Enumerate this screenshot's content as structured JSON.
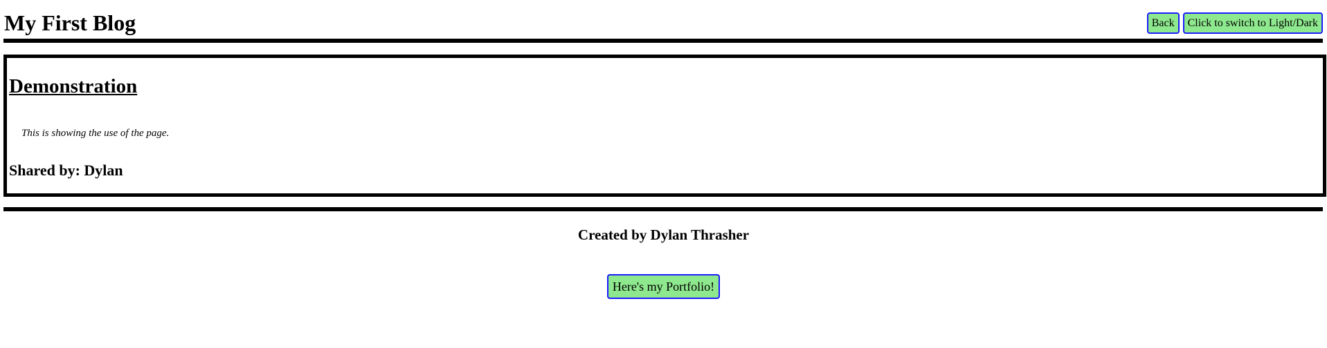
{
  "header": {
    "title": "My First Blog",
    "back_label": "Back",
    "theme_toggle_label": "Click to switch to Light/Dark"
  },
  "post": {
    "title": "Demonstration",
    "body": "This is showing the use of the page.",
    "shared_by": "Shared by: Dylan"
  },
  "footer": {
    "credit": "Created by Dylan Thrasher",
    "portfolio_label": "Here's my Portfolio!"
  },
  "colors": {
    "button_bg": "#8ee88e",
    "button_border": "#1a1aff",
    "rule": "#000000",
    "background": "#ffffff"
  }
}
